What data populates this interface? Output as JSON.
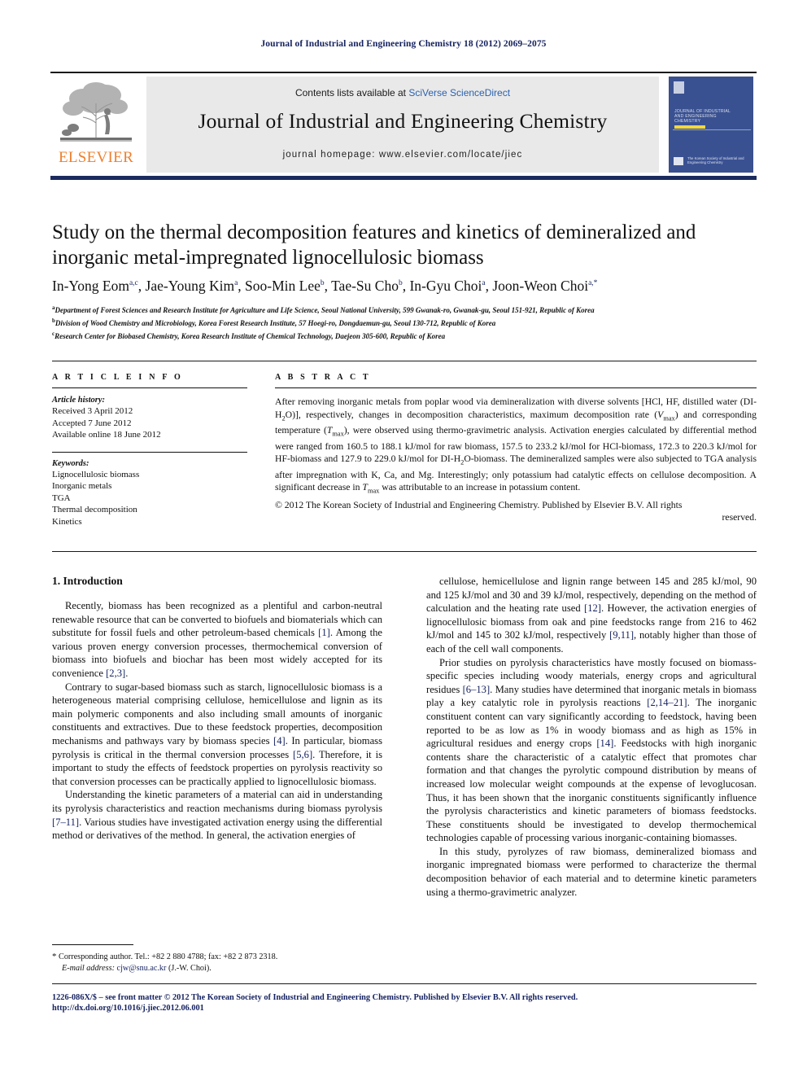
{
  "running_head": "Journal of Industrial and Engineering Chemistry 18 (2012) 2069–2075",
  "masthead": {
    "contents_prefix": "Contents lists available at ",
    "contents_link": "SciVerse ScienceDirect",
    "journal_title": "Journal of Industrial and Engineering Chemistry",
    "homepage": "journal homepage: www.elsevier.com/locate/jiec",
    "publisher_logo_text": "ELSEVIER",
    "cover": {
      "title": "JOURNAL OF INDUSTRIAL AND ENGINEERING CHEMISTRY",
      "footer": "The Korean Society of Industrial and Engineering Chemistry"
    }
  },
  "article": {
    "title": "Study on the thermal decomposition features and kinetics of demineralized and inorganic metal-impregnated lignocellulosic biomass",
    "authors": [
      {
        "name": "In-Yong Eom",
        "marks": "a,c"
      },
      {
        "name": "Jae-Young Kim",
        "marks": "a"
      },
      {
        "name": "Soo-Min Lee",
        "marks": "b"
      },
      {
        "name": "Tae-Su Cho",
        "marks": "b"
      },
      {
        "name": "In-Gyu Choi",
        "marks": "a"
      },
      {
        "name": "Joon-Weon Choi",
        "marks": "a,*"
      }
    ],
    "affiliations": [
      {
        "mark": "a",
        "text": "Department of Forest Sciences and Research Institute for Agriculture and Life Science, Seoul National University, 599 Gwanak-ro, Gwanak-gu, Seoul 151-921, Republic of Korea"
      },
      {
        "mark": "b",
        "text": "Division of Wood Chemistry and Microbiology, Korea Forest Research Institute, 57 Hoegi-ro, Dongdaemun-gu, Seoul 130-712, Republic of Korea"
      },
      {
        "mark": "c",
        "text": "Research Center for Biobased Chemistry, Korea Research Institute of Chemical Technology, Daejeon 305-600, Republic of Korea"
      }
    ]
  },
  "info": {
    "heading": "A R T I C L E   I N F O",
    "history_label": "Article history:",
    "history": [
      "Received 3 April 2012",
      "Accepted 7 June 2012",
      "Available online 18 June 2012"
    ],
    "keywords_label": "Keywords:",
    "keywords": [
      "Lignocellulosic biomass",
      "Inorganic metals",
      "TGA",
      "Thermal decomposition",
      "Kinetics"
    ]
  },
  "abstract": {
    "heading": "A B S T R A C T",
    "part1": "After removing inorganic metals from poplar wood via demineralization with diverse solvents [HCl, HF, distilled water (DI-H",
    "sub1": "2",
    "part2": "O)], respectively, changes in decomposition characteristics, maximum decomposition rate (",
    "vmax": "V",
    "vmax_sub": "max",
    "part3": ") and corresponding temperature (",
    "tmax": "T",
    "tmax_sub": "max",
    "part4": "), were observed using thermo-gravimetric analysis. Activation energies calculated by differential method were ranged from 160.5 to 188.1 kJ/mol for raw biomass, 157.5 to 233.2 kJ/mol for HCl-biomass, 172.3 to 220.3 kJ/mol for HF-biomass and 127.9 to 229.0 kJ/mol for DI-H",
    "sub2": "2",
    "part5": "O-biomass. The demineralized samples were also subjected to TGA analysis after impregnation with K, Ca, and Mg. Interestingly; only potassium had catalytic effects on cellulose decomposition. A significant decrease in ",
    "tmax2": "T",
    "tmax2_sub": "max",
    "part6": " was attributable to an increase in potassium content.",
    "copyright": "© 2012 The Korean Society of Industrial and Engineering Chemistry. Published by Elsevier B.V. All rights",
    "copyright_last": "reserved."
  },
  "body": {
    "section_heading": "1.  Introduction",
    "left_paragraphs": [
      "Recently, biomass has been recognized as a plentiful and carbon-neutral renewable resource that can be converted to biofuels and biomaterials which can substitute for fossil fuels and other petroleum-based chemicals [1]. Among the various proven energy conversion processes, thermochemical conversion of biomass into biofuels and biochar has been most widely accepted for its convenience [2,3].",
      "Contrary to sugar-based biomass such as starch, lignocellulosic biomass is a heterogeneous material comprising cellulose, hemicellulose and lignin as its main polymeric components and also including small amounts of inorganic constituents and extractives. Due to these feedstock properties, decomposition mechanisms and pathways vary by biomass species [4]. In particular, biomass pyrolysis is critical in the thermal conversion processes [5,6]. Therefore, it is important to study the effects of feedstock properties on pyrolysis reactivity so that conversion processes can be practically applied to lignocellulosic biomass.",
      "Understanding the kinetic parameters of a material can aid in understanding its pyrolysis characteristics and reaction mechanisms during biomass pyrolysis [7–11]. Various studies have investigated activation energy using the differential method or derivatives of the method. In general, the activation energies of"
    ],
    "right_paragraphs": [
      "cellulose, hemicellulose and lignin range between 145 and 285 kJ/mol, 90 and 125 kJ/mol and 30 and 39 kJ/mol, respectively, depending on the method of calculation and the heating rate used [12]. However, the activation energies of lignocellulosic biomass from oak and pine feedstocks range from 216 to 462 kJ/mol and 145 to 302 kJ/mol, respectively [9,11], notably higher than those of each of the cell wall components.",
      "Prior studies on pyrolysis characteristics have mostly focused on biomass-specific species including woody materials, energy crops and agricultural residues [6–13]. Many studies have determined that inorganic metals in biomass play a key catalytic role in pyrolysis reactions [2,14–21]. The inorganic constituent content can vary significantly according to feedstock, having been reported to be as low as 1% in woody biomass and as high as 15% in agricultural residues and energy crops [14]. Feedstocks with high inorganic contents share the characteristic of a catalytic effect that promotes char formation and that changes the pyrolytic compound distribution by means of increased low molecular weight compounds at the expense of levoglucosan. Thus, it has been shown that the inorganic constituents significantly influence the pyrolysis characteristics and kinetic parameters of biomass feedstocks. These constituents should be investigated to develop thermochemical technologies capable of processing various inorganic-containing biomasses.",
      "In this study, pyrolyzes of raw biomass, demineralized biomass and inorganic impregnated biomass were performed to characterize the thermal decomposition behavior of each material and to determine kinetic parameters using a thermo-gravimetric analyzer."
    ]
  },
  "footnote": {
    "marker": "*",
    "corresponding": "Corresponding author. Tel.: +82 2 880 4788; fax: +82 2 873 2318.",
    "email_label": "E-mail address:",
    "email": "cjw@snu.ac.kr",
    "email_suffix": "(J.-W. Choi)."
  },
  "footer": {
    "imprint": "1226-086X/$ – see front matter © 2012 The Korean Society of Industrial and Engineering Chemistry. Published by Elsevier B.V. All rights reserved.",
    "doi": "http://dx.doi.org/10.1016/j.jiec.2012.06.001"
  }
}
